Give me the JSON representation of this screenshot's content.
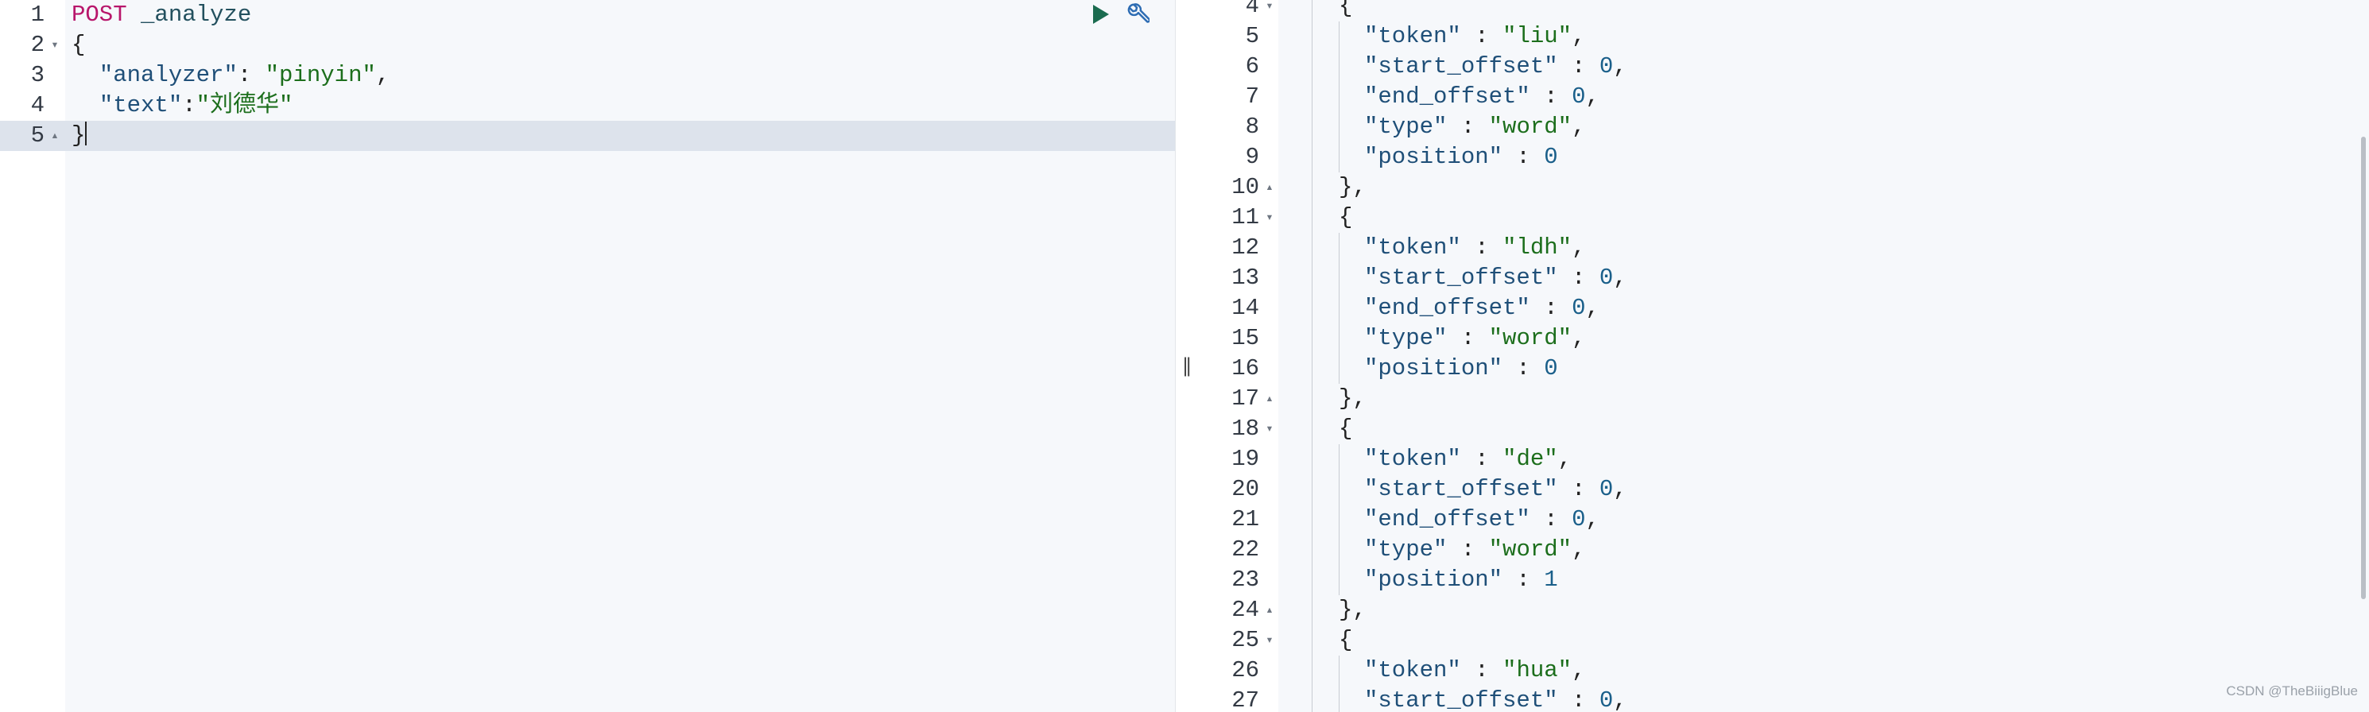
{
  "request": {
    "lines": [
      {
        "num": "1",
        "fold": "",
        "parts": [
          {
            "t": "POST",
            "c": "tok-method"
          },
          {
            "t": " ",
            "c": "tok-punct"
          },
          {
            "t": "_analyze",
            "c": "tok-url"
          }
        ]
      },
      {
        "num": "2",
        "fold": "▾",
        "parts": [
          {
            "t": "{",
            "c": "tok-brace"
          }
        ]
      },
      {
        "num": "3",
        "fold": "",
        "parts": [
          {
            "t": "  ",
            "c": "tok-punct"
          },
          {
            "t": "\"analyzer\"",
            "c": "tok-key"
          },
          {
            "t": ": ",
            "c": "tok-punct"
          },
          {
            "t": "\"pinyin\"",
            "c": "tok-str"
          },
          {
            "t": ",",
            "c": "tok-punct"
          }
        ]
      },
      {
        "num": "4",
        "fold": "",
        "parts": [
          {
            "t": "  ",
            "c": "tok-punct"
          },
          {
            "t": "\"text\"",
            "c": "tok-key"
          },
          {
            "t": ":",
            "c": "tok-punct"
          },
          {
            "t": "\"刘德华\"",
            "c": "tok-str"
          }
        ]
      },
      {
        "num": "5",
        "fold": "▴",
        "active": true,
        "parts": [
          {
            "t": "}",
            "c": "tok-brace"
          }
        ]
      }
    ]
  },
  "toolbar": {
    "run_icon": "play-icon",
    "settings_icon": "wrench-icon",
    "play_color": "#1a6b4f",
    "wrench_color": "#2d6cb3"
  },
  "divider": {
    "handle": "||"
  },
  "response": {
    "lines": [
      {
        "num": "4",
        "fold": "▾",
        "indent": 1,
        "parts": [
          {
            "t": "{",
            "c": "tok-brace"
          }
        ]
      },
      {
        "num": "5",
        "fold": "",
        "indent": 2,
        "parts": [
          {
            "t": "\"token\"",
            "c": "tok-key"
          },
          {
            "t": " : ",
            "c": "tok-punct"
          },
          {
            "t": "\"liu\"",
            "c": "tok-str"
          },
          {
            "t": ",",
            "c": "tok-punct"
          }
        ]
      },
      {
        "num": "6",
        "fold": "",
        "indent": 2,
        "parts": [
          {
            "t": "\"start_offset\"",
            "c": "tok-key"
          },
          {
            "t": " : ",
            "c": "tok-punct"
          },
          {
            "t": "0",
            "c": "tok-num"
          },
          {
            "t": ",",
            "c": "tok-punct"
          }
        ]
      },
      {
        "num": "7",
        "fold": "",
        "indent": 2,
        "parts": [
          {
            "t": "\"end_offset\"",
            "c": "tok-key"
          },
          {
            "t": " : ",
            "c": "tok-punct"
          },
          {
            "t": "0",
            "c": "tok-num"
          },
          {
            "t": ",",
            "c": "tok-punct"
          }
        ]
      },
      {
        "num": "8",
        "fold": "",
        "indent": 2,
        "parts": [
          {
            "t": "\"type\"",
            "c": "tok-key"
          },
          {
            "t": " : ",
            "c": "tok-punct"
          },
          {
            "t": "\"word\"",
            "c": "tok-str"
          },
          {
            "t": ",",
            "c": "tok-punct"
          }
        ]
      },
      {
        "num": "9",
        "fold": "",
        "indent": 2,
        "parts": [
          {
            "t": "\"position\"",
            "c": "tok-key"
          },
          {
            "t": " : ",
            "c": "tok-punct"
          },
          {
            "t": "0",
            "c": "tok-num"
          }
        ]
      },
      {
        "num": "10",
        "fold": "▴",
        "indent": 1,
        "parts": [
          {
            "t": "},",
            "c": "tok-brace"
          }
        ]
      },
      {
        "num": "11",
        "fold": "▾",
        "indent": 1,
        "parts": [
          {
            "t": "{",
            "c": "tok-brace"
          }
        ]
      },
      {
        "num": "12",
        "fold": "",
        "indent": 2,
        "parts": [
          {
            "t": "\"token\"",
            "c": "tok-key"
          },
          {
            "t": " : ",
            "c": "tok-punct"
          },
          {
            "t": "\"ldh\"",
            "c": "tok-str"
          },
          {
            "t": ",",
            "c": "tok-punct"
          }
        ]
      },
      {
        "num": "13",
        "fold": "",
        "indent": 2,
        "parts": [
          {
            "t": "\"start_offset\"",
            "c": "tok-key"
          },
          {
            "t": " : ",
            "c": "tok-punct"
          },
          {
            "t": "0",
            "c": "tok-num"
          },
          {
            "t": ",",
            "c": "tok-punct"
          }
        ]
      },
      {
        "num": "14",
        "fold": "",
        "indent": 2,
        "parts": [
          {
            "t": "\"end_offset\"",
            "c": "tok-key"
          },
          {
            "t": " : ",
            "c": "tok-punct"
          },
          {
            "t": "0",
            "c": "tok-num"
          },
          {
            "t": ",",
            "c": "tok-punct"
          }
        ]
      },
      {
        "num": "15",
        "fold": "",
        "indent": 2,
        "parts": [
          {
            "t": "\"type\"",
            "c": "tok-key"
          },
          {
            "t": " : ",
            "c": "tok-punct"
          },
          {
            "t": "\"word\"",
            "c": "tok-str"
          },
          {
            "t": ",",
            "c": "tok-punct"
          }
        ]
      },
      {
        "num": "16",
        "fold": "",
        "indent": 2,
        "parts": [
          {
            "t": "\"position\"",
            "c": "tok-key"
          },
          {
            "t": " : ",
            "c": "tok-punct"
          },
          {
            "t": "0",
            "c": "tok-num"
          }
        ]
      },
      {
        "num": "17",
        "fold": "▴",
        "indent": 1,
        "parts": [
          {
            "t": "},",
            "c": "tok-brace"
          }
        ]
      },
      {
        "num": "18",
        "fold": "▾",
        "indent": 1,
        "parts": [
          {
            "t": "{",
            "c": "tok-brace"
          }
        ]
      },
      {
        "num": "19",
        "fold": "",
        "indent": 2,
        "parts": [
          {
            "t": "\"token\"",
            "c": "tok-key"
          },
          {
            "t": " : ",
            "c": "tok-punct"
          },
          {
            "t": "\"de\"",
            "c": "tok-str"
          },
          {
            "t": ",",
            "c": "tok-punct"
          }
        ]
      },
      {
        "num": "20",
        "fold": "",
        "indent": 2,
        "parts": [
          {
            "t": "\"start_offset\"",
            "c": "tok-key"
          },
          {
            "t": " : ",
            "c": "tok-punct"
          },
          {
            "t": "0",
            "c": "tok-num"
          },
          {
            "t": ",",
            "c": "tok-punct"
          }
        ]
      },
      {
        "num": "21",
        "fold": "",
        "indent": 2,
        "parts": [
          {
            "t": "\"end_offset\"",
            "c": "tok-key"
          },
          {
            "t": " : ",
            "c": "tok-punct"
          },
          {
            "t": "0",
            "c": "tok-num"
          },
          {
            "t": ",",
            "c": "tok-punct"
          }
        ]
      },
      {
        "num": "22",
        "fold": "",
        "indent": 2,
        "parts": [
          {
            "t": "\"type\"",
            "c": "tok-key"
          },
          {
            "t": " : ",
            "c": "tok-punct"
          },
          {
            "t": "\"word\"",
            "c": "tok-str"
          },
          {
            "t": ",",
            "c": "tok-punct"
          }
        ]
      },
      {
        "num": "23",
        "fold": "",
        "indent": 2,
        "parts": [
          {
            "t": "\"position\"",
            "c": "tok-key"
          },
          {
            "t": " : ",
            "c": "tok-punct"
          },
          {
            "t": "1",
            "c": "tok-num"
          }
        ]
      },
      {
        "num": "24",
        "fold": "▴",
        "indent": 1,
        "parts": [
          {
            "t": "},",
            "c": "tok-brace"
          }
        ]
      },
      {
        "num": "25",
        "fold": "▾",
        "indent": 1,
        "parts": [
          {
            "t": "{",
            "c": "tok-brace"
          }
        ]
      },
      {
        "num": "26",
        "fold": "",
        "indent": 2,
        "parts": [
          {
            "t": "\"token\"",
            "c": "tok-key"
          },
          {
            "t": " : ",
            "c": "tok-punct"
          },
          {
            "t": "\"hua\"",
            "c": "tok-str"
          },
          {
            "t": ",",
            "c": "tok-punct"
          }
        ]
      },
      {
        "num": "27",
        "fold": "",
        "indent": 2,
        "parts": [
          {
            "t": "\"start_offset\"",
            "c": "tok-key"
          },
          {
            "t": " : ",
            "c": "tok-punct"
          },
          {
            "t": "0",
            "c": "tok-num"
          },
          {
            "t": ",",
            "c": "tok-punct"
          }
        ]
      }
    ]
  },
  "watermark": "CSDN @TheBiiigBlue"
}
